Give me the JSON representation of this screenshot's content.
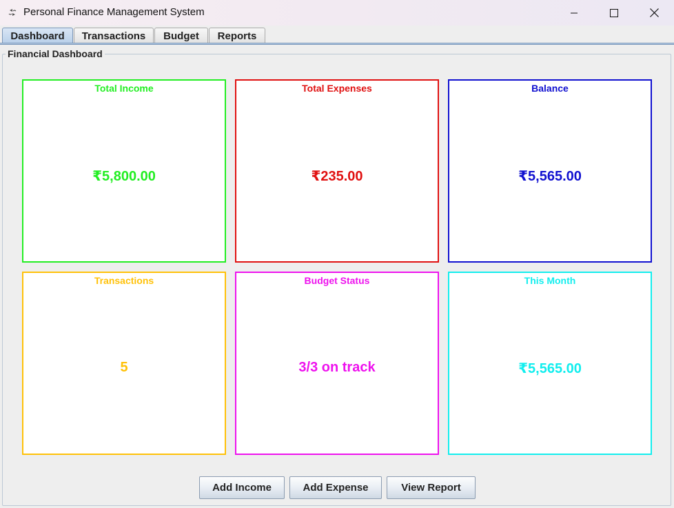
{
  "window": {
    "title": "Personal Finance Management System",
    "icon": "app-finance-icon"
  },
  "tabs": [
    {
      "label": "Dashboard",
      "active": true
    },
    {
      "label": "Transactions",
      "active": false
    },
    {
      "label": "Budget",
      "active": false
    },
    {
      "label": "Reports",
      "active": false
    }
  ],
  "dashboard": {
    "title": "Financial Dashboard",
    "cards": [
      {
        "label": "Total Income",
        "value": "₹5,800.00",
        "color": "#22ee22"
      },
      {
        "label": "Total Expenses",
        "value": "₹235.00",
        "color": "#e01010"
      },
      {
        "label": "Balance",
        "value": "₹5,565.00",
        "color": "#1010d0"
      },
      {
        "label": "Transactions",
        "value": "5",
        "color": "#ffc107"
      },
      {
        "label": "Budget Status",
        "value": "3/3 on track",
        "color": "#ee11ee"
      },
      {
        "label": "This Month",
        "value": "₹5,565.00",
        "color": "#11eeee"
      }
    ]
  },
  "actions": {
    "add_income": "Add Income",
    "add_expense": "Add Expense",
    "view_report": "View Report"
  }
}
